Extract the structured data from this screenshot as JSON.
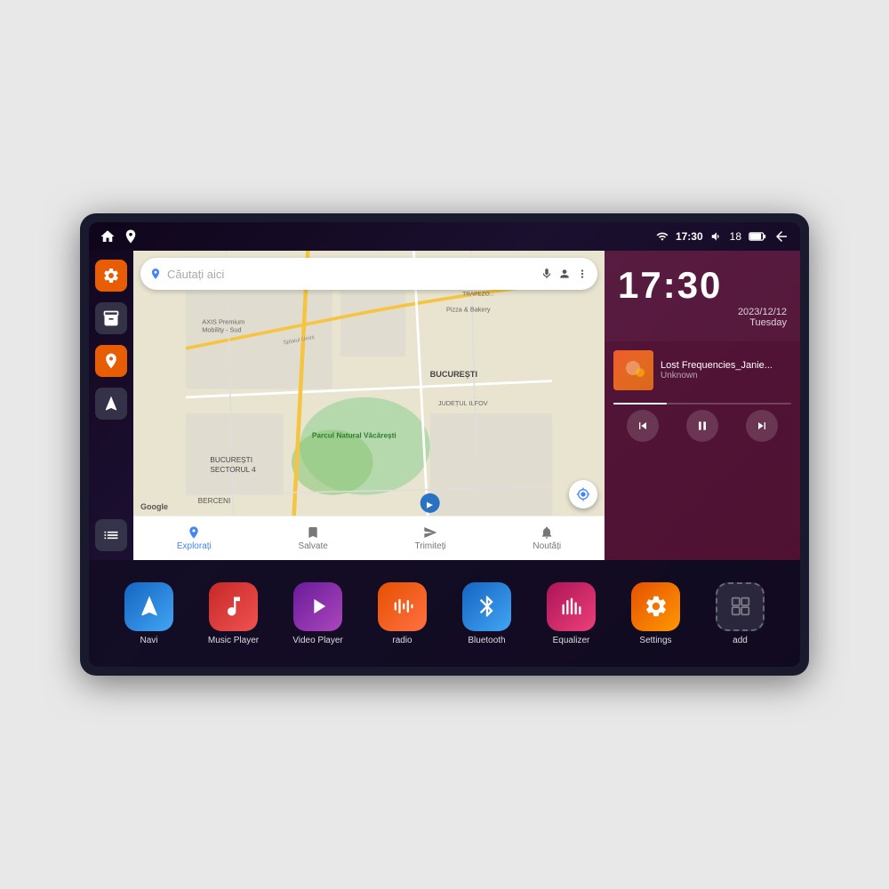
{
  "device": {
    "status_bar": {
      "time": "17:30",
      "battery": "18",
      "wifi_icon": "wifi",
      "volume_icon": "volume",
      "battery_icon": "battery",
      "back_icon": "back"
    },
    "clock": {
      "time": "17:30",
      "date": "2023/12/12",
      "day": "Tuesday"
    },
    "music": {
      "song_title": "Lost Frequencies_Janie...",
      "artist": "Unknown",
      "progress": 30
    },
    "map": {
      "search_placeholder": "Căutați aici",
      "locations": [
        "AXIS Premium Mobility - Sud",
        "Pizza & Bakery",
        "Parcul Natural Văcărești",
        "BUCUREȘTI",
        "JUDEȚUL ILFOV",
        "BUCUREȘTI SECTORUL 4",
        "BERCENI"
      ],
      "nav_items": [
        {
          "label": "Explorați",
          "active": true
        },
        {
          "label": "Salvate",
          "active": false
        },
        {
          "label": "Trimiteți",
          "active": false
        },
        {
          "label": "Noutăți",
          "active": false
        }
      ]
    },
    "sidebar": {
      "items": [
        {
          "icon": "settings",
          "color": "orange"
        },
        {
          "icon": "archive",
          "color": "dark"
        },
        {
          "icon": "map",
          "color": "orange"
        },
        {
          "icon": "navigation",
          "color": "dark"
        }
      ],
      "bottom": {
        "icon": "grid",
        "color": "dark"
      }
    },
    "apps": [
      {
        "id": "navi",
        "label": "Navi",
        "icon": "▲",
        "class": "app-navi"
      },
      {
        "id": "music-player",
        "label": "Music Player",
        "icon": "♪",
        "class": "app-music"
      },
      {
        "id": "video-player",
        "label": "Video Player",
        "icon": "▶",
        "class": "app-video"
      },
      {
        "id": "radio",
        "label": "radio",
        "icon": "≋",
        "class": "app-radio"
      },
      {
        "id": "bluetooth",
        "label": "Bluetooth",
        "icon": "ᛒ",
        "class": "app-bt"
      },
      {
        "id": "equalizer",
        "label": "Equalizer",
        "icon": "⫿",
        "class": "app-eq"
      },
      {
        "id": "settings",
        "label": "Settings",
        "icon": "⚙",
        "class": "app-settings"
      },
      {
        "id": "add",
        "label": "add",
        "icon": "⊞",
        "class": "app-add"
      }
    ]
  }
}
